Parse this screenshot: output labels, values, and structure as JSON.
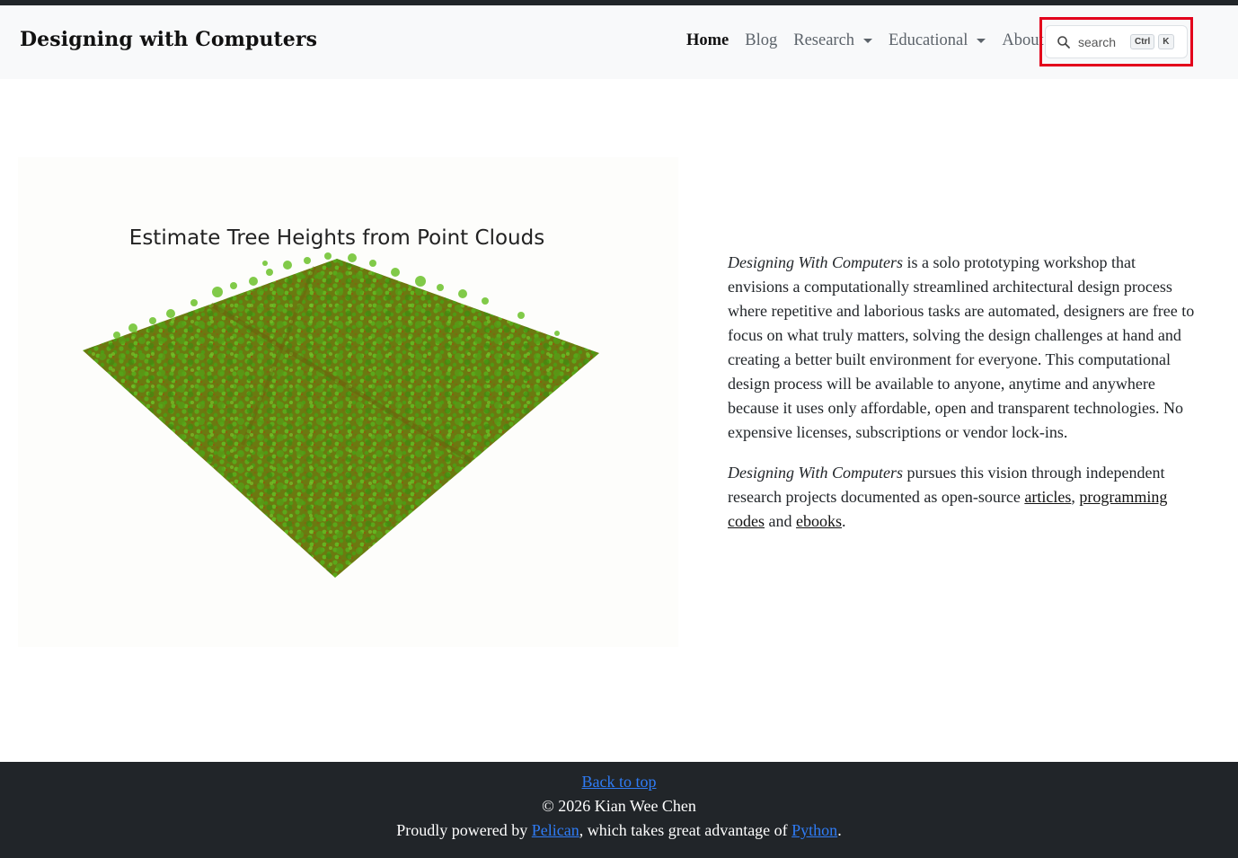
{
  "site": {
    "title": "Designing with Computers"
  },
  "nav": {
    "items": [
      {
        "label": "Home",
        "active": true,
        "dropdown": false
      },
      {
        "label": "Blog",
        "active": false,
        "dropdown": false
      },
      {
        "label": "Research",
        "active": false,
        "dropdown": true
      },
      {
        "label": "Educational",
        "active": false,
        "dropdown": true
      },
      {
        "label": "About",
        "active": false,
        "dropdown": false
      }
    ]
  },
  "search": {
    "placeholder": "search",
    "shortcut": [
      "Ctrl",
      "K"
    ],
    "icon": "search-icon",
    "highlight_color": "#e3001b"
  },
  "hero": {
    "image_caption": "Estimate Tree Heights from Point Clouds"
  },
  "intro": {
    "p1_em": "Designing With Computers",
    "p1_text": " is a solo prototyping workshop that envisions a computationally streamlined architectural design process where repetitive and laborious tasks are automated, designers are free to focus on what truly matters, solving the design challenges at hand and creating a better built environment for everyone. This computational design process will be available to anyone, anytime and anywhere because it uses only affordable, open and transparent technologies. No expensive licenses, subscriptions or vendor lock-ins.",
    "p2_em": "Designing With Computers",
    "p2_text": " pursues this vision through independent research projects documented as open-source ",
    "link_articles": "articles",
    "sep1": ", ",
    "link_codes": "programming codes",
    "sep2": " and ",
    "link_ebooks": "ebooks",
    "end": "."
  },
  "footer": {
    "back_to_top": "Back to top",
    "copyright": "© 2026 Kian Wee Chen",
    "powered_prefix": "Proudly powered by ",
    "pelican": "Pelican",
    "powered_mid": ", which takes great advantage of ",
    "python": "Python",
    "powered_end": "."
  },
  "colors": {
    "navbar_bg": "#f8f9fa",
    "footer_bg": "#212529",
    "link_blue": "#2f7cf6",
    "foliage_green": "#4f8a12"
  }
}
